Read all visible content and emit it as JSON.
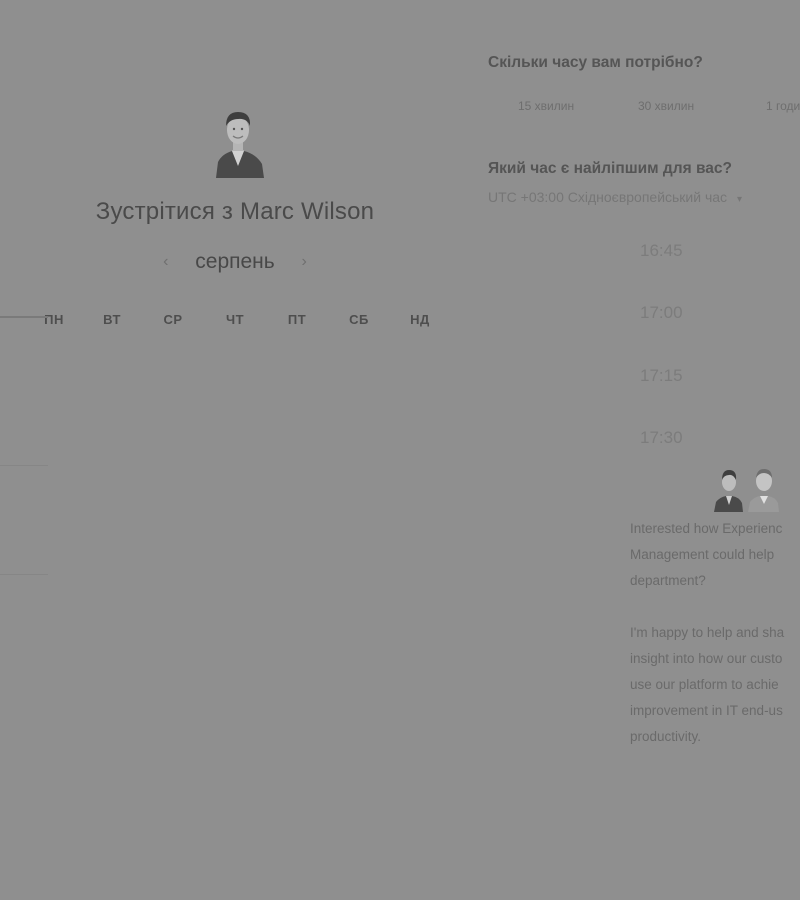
{
  "host": {
    "title": "Зустрітися з Marc Wilson",
    "avatar_icon": "person-avatar-icon"
  },
  "calendar": {
    "month": "серпень",
    "prev_icon": "chevron-left-icon",
    "next_icon": "chevron-right-icon",
    "weekdays": [
      "ПН",
      "ВТ",
      "СР",
      "ЧТ",
      "ПТ",
      "СБ",
      "НД"
    ]
  },
  "duration": {
    "question": "Скільки часу вам потрібно?",
    "options": [
      "15 хвилин",
      "30 хвилин",
      "1 годи"
    ]
  },
  "time": {
    "question": "Який час є найліпшим для вас?",
    "timezone": "UTC +03:00 Східноєвропейський час",
    "timezone_icon": "caret-down-icon",
    "slots": [
      "16:45",
      "17:00",
      "17:15",
      "17:30"
    ]
  },
  "promo": {
    "avatars_icon": "two-person-avatars-icon",
    "paragraph1": [
      "Interested how Experienc",
      "Management could help",
      "department?"
    ],
    "paragraph2": [
      "I'm happy to help and sha",
      "insight into how our custo",
      "use our platform to achie",
      "improvement in IT end-us",
      "productivity."
    ]
  },
  "colors": {
    "overlay": "#8f8f8f",
    "text_dark": "#4a4a4a",
    "text_muted": "#767676"
  }
}
